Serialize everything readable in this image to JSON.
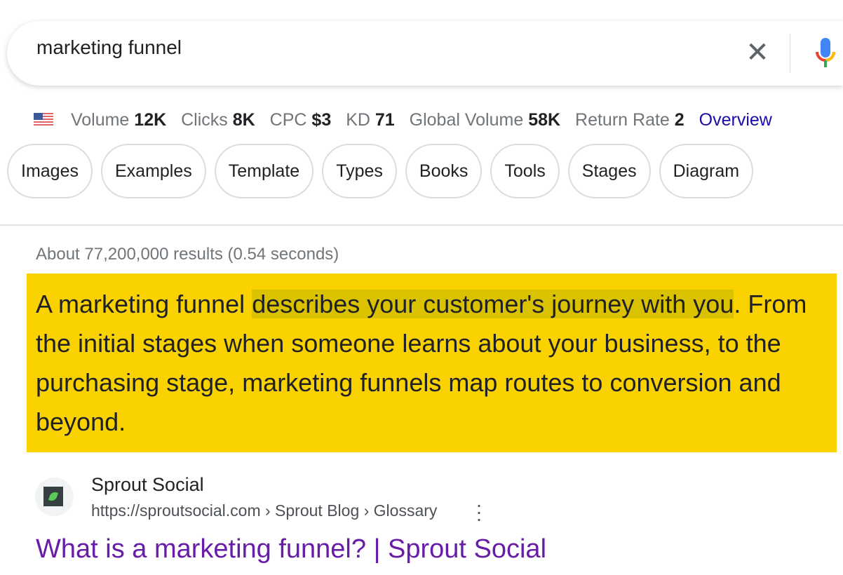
{
  "search": {
    "query": "marketing funnel"
  },
  "metrics": [
    {
      "label": "Volume",
      "value": "12K"
    },
    {
      "label": "Clicks",
      "value": "8K"
    },
    {
      "label": "CPC",
      "value": "$3"
    },
    {
      "label": "KD",
      "value": "71"
    },
    {
      "label": "Global Volume",
      "value": "58K"
    },
    {
      "label": "Return Rate",
      "value": "2"
    }
  ],
  "overview_link": "Overview",
  "chips": [
    "Images",
    "Examples",
    "Template",
    "Types",
    "Books",
    "Tools",
    "Stages",
    "Diagram"
  ],
  "results_count": "About 77,200,000 results (0.54 seconds)",
  "snippet": {
    "before": "A marketing funnel ",
    "highlight": "describes your customer's journey with you",
    "after": ". From the initial stages when someone learns about your business, to the purchasing stage, marketing funnels map routes to conversion and beyond."
  },
  "result": {
    "source": "Sprout Social",
    "url": "https://sproutsocial.com › Sprout Blog › Glossary",
    "title": "What is a marketing funnel? | Sprout Social"
  },
  "colors": {
    "snippet_bg": "#fad200",
    "highlight": "#dbc200",
    "link_visited": "#681da8",
    "link": "#1a0dab"
  }
}
